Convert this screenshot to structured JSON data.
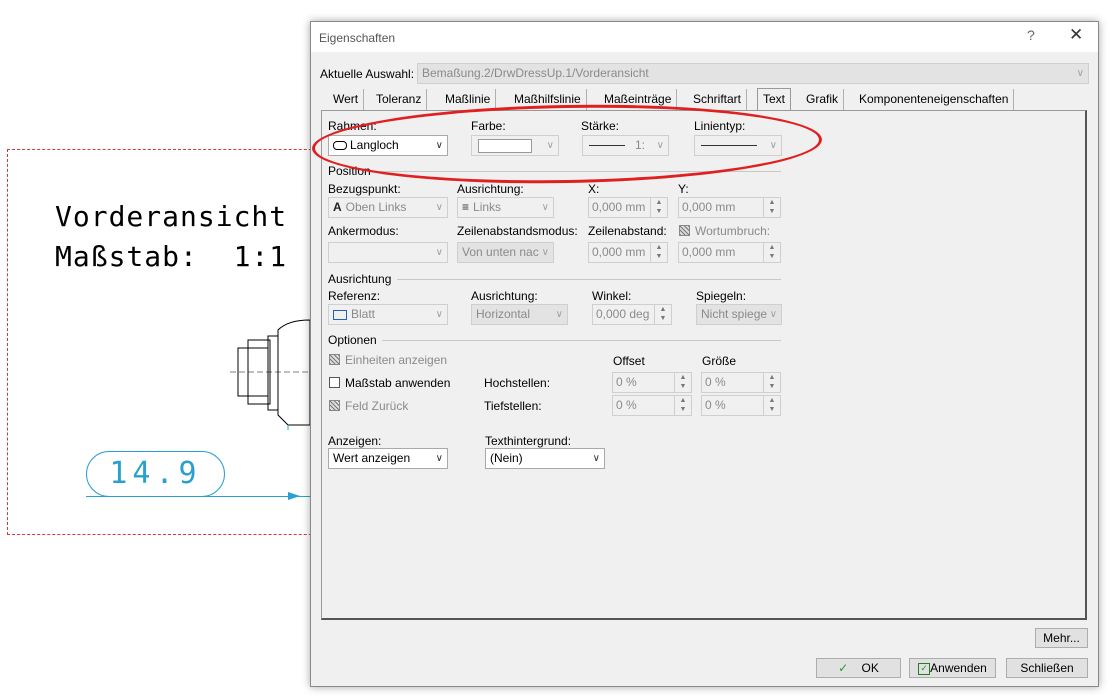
{
  "background": {
    "view_name": "Vorderansicht",
    "scale_text": "Maßstab:  1:1",
    "dimension_value": "14.9",
    "colors": {
      "frame": "#d23a3a",
      "dimension": "#2aa0d0"
    }
  },
  "dialog": {
    "title": "Eigenschaften",
    "help": "?",
    "close": "✕",
    "current_selection_label": "Aktuelle Auswahl:",
    "current_selection_value": "Bemaßung.2/DrwDressUp.1/Vorderansicht",
    "tabs": [
      "Wert",
      "Toleranz",
      "Maßlinie",
      "Maßhilfslinie",
      "Maßeinträge",
      "Schriftart",
      "Text",
      "Grafik",
      "Komponenteneigenschaften"
    ],
    "active_tab": "Text",
    "frame": {
      "rahmen_label": "Rahmen:",
      "rahmen_value": "Langloch",
      "farbe_label": "Farbe:",
      "staerke_label": "Stärke:",
      "staerke_value": "1:",
      "linientyp_label": "Linientyp:"
    },
    "position": {
      "group": "Position",
      "bezugspunkt_label": "Bezugspunkt:",
      "bezugspunkt_value": "Oben Links",
      "ausrichtung_label": "Ausrichtung:",
      "ausrichtung_value": "Links",
      "x_label": "X:",
      "x_value": "0,000 mm",
      "y_label": "Y:",
      "y_value": "0,000 mm",
      "ankermodus_label": "Ankermodus:",
      "zeilenabstandsmodus_label": "Zeilenabstandsmodus:",
      "zeilenabstandsmodus_value": "Von unten nac",
      "zeilenabstand_label": "Zeilenabstand:",
      "zeilenabstand_value": "0,000 mm",
      "wortumbruch_label": "Wortumbruch:",
      "wortumbruch_value": "0,000 mm"
    },
    "ausrichtung": {
      "group": "Ausrichtung",
      "referenz_label": "Referenz:",
      "referenz_value": "Blatt",
      "ausrichtung_label": "Ausrichtung:",
      "ausrichtung_value": "Horizontal",
      "winkel_label": "Winkel:",
      "winkel_value": "0,000 deg",
      "spiegeln_label": "Spiegeln:",
      "spiegeln_value": "Nicht spiege"
    },
    "optionen": {
      "group": "Optionen",
      "einheiten": "Einheiten anzeigen",
      "massstab": "Maßstab anwenden",
      "feld": "Feld Zurück",
      "offset_header": "Offset",
      "groesse_header": "Größe",
      "hochstellen_label": "Hochstellen:",
      "tiefstellen_label": "Tiefstellen:",
      "hoch_offset": "0 %",
      "hoch_groesse": "0 %",
      "tief_offset": "0 %",
      "tief_groesse": "0 %"
    },
    "anzeigen_label": "Anzeigen:",
    "anzeigen_value": "Wert anzeigen",
    "texthintergrund_label": "Texthintergrund:",
    "texthintergrund_value": "(Nein)",
    "buttons": {
      "more": "Mehr...",
      "ok": "OK",
      "apply": "Anwenden",
      "close": "Schließen"
    }
  }
}
